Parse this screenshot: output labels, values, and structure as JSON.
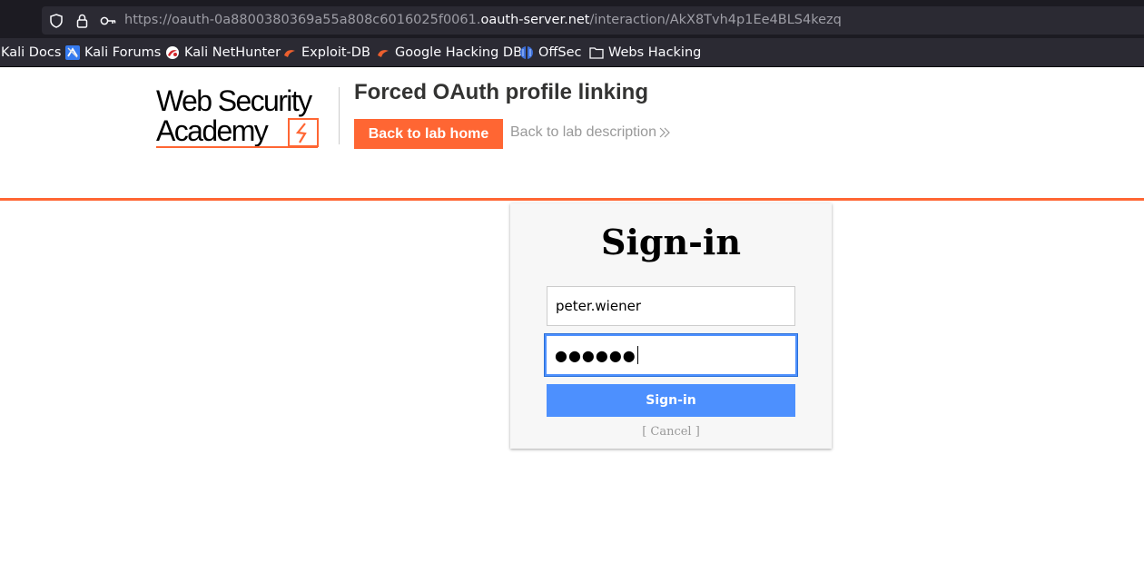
{
  "browser": {
    "url_prefix": "https://oauth-0a8800380369a55a808c6016025f0061.",
    "url_host": "oauth-server.net",
    "url_path": "/interaction/AkX8Tvh4p1Ee4BLS4kezq",
    "icons": [
      "shield-icon",
      "lock-icon",
      "key-icon"
    ]
  },
  "bookmarks": [
    {
      "label": "Kali Docs",
      "icon": "kali-icon"
    },
    {
      "label": "Kali Forums",
      "icon": "kali-forums-icon"
    },
    {
      "label": "Kali NetHunter",
      "icon": "nethunter-icon"
    },
    {
      "label": "Exploit-DB",
      "icon": "exploitdb-icon"
    },
    {
      "label": "Google Hacking DB",
      "icon": "ghdb-icon"
    },
    {
      "label": "OffSec",
      "icon": "offsec-icon"
    },
    {
      "label": "Webs Hacking",
      "icon": "folder-icon"
    }
  ],
  "lab": {
    "logo_line1": "Web Security",
    "logo_line2": "Academy",
    "title": "Forced OAuth profile linking",
    "back_home": "Back to lab home",
    "back_description": "Back to lab description",
    "accent_color": "#ff6633"
  },
  "signin": {
    "title": "Sign-in",
    "username_value": "peter.wiener",
    "password_mask": "●●●●●●",
    "submit_label": "Sign-in",
    "cancel_label": "[ Cancel ]",
    "button_color": "#4d90fe"
  }
}
